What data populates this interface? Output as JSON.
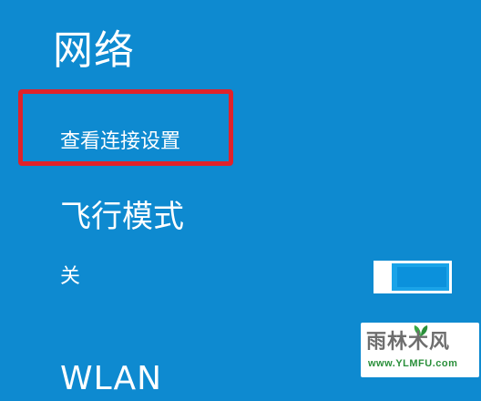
{
  "panel": {
    "title": "网络",
    "view_settings_link": "查看连接设置",
    "airplane_mode": {
      "heading": "飞行模式",
      "state_label": "关",
      "enabled": false
    },
    "next_section": "WLAN"
  },
  "colors": {
    "background": "#0e8ad0",
    "highlight": "#e0222a",
    "toggle_track": "#0b91dc"
  },
  "watermark": {
    "logo_text": "雨林木风",
    "url": "www.YLMFU.com"
  }
}
